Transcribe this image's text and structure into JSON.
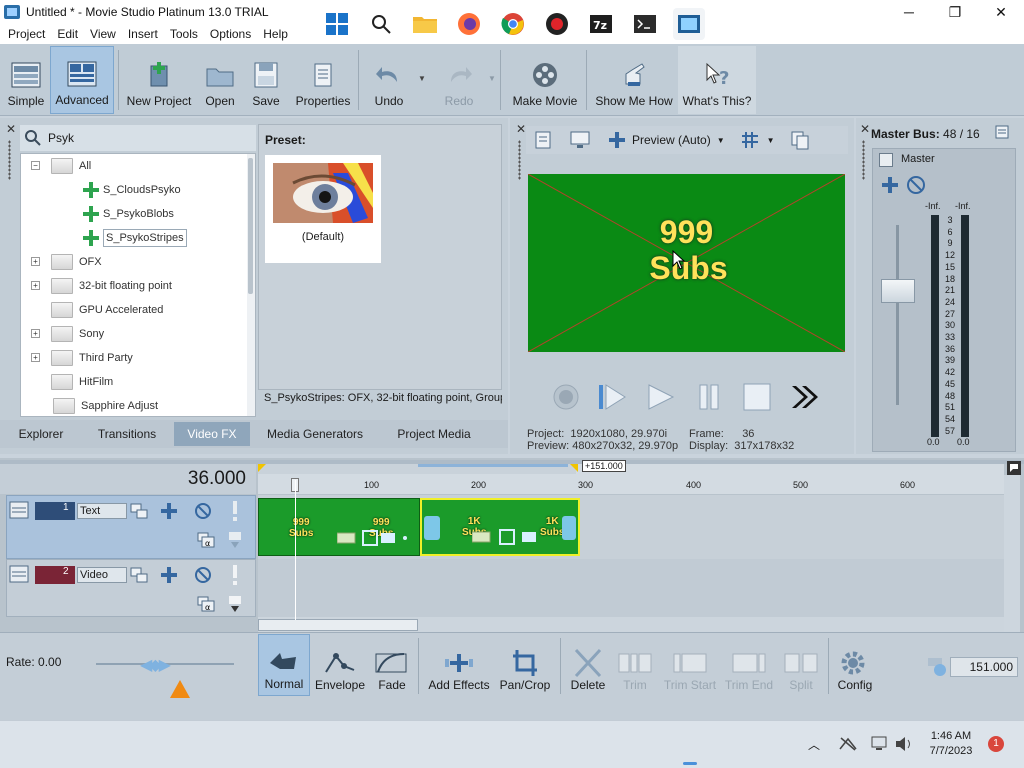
{
  "window": {
    "title": "Untitled * - Movie Studio Platinum 13.0 TRIAL",
    "controls": [
      "─",
      "❐",
      "✕"
    ]
  },
  "menu": [
    "Project",
    "Edit",
    "View",
    "Insert",
    "Tools",
    "Options",
    "Help"
  ],
  "toolbar": {
    "simple": "Simple",
    "advanced": "Advanced",
    "new_project": "New Project",
    "open": "Open",
    "save": "Save",
    "properties": "Properties",
    "undo": "Undo",
    "redo": "Redo",
    "make_movie": "Make Movie",
    "show_me_how": "Show Me How",
    "whats_this": "What's This?"
  },
  "explorer": {
    "search_value": "Psyk",
    "preset_label": "Preset:",
    "preset_default": "(Default)",
    "tree": [
      {
        "label": "All",
        "type": "folder",
        "expander": "−"
      },
      {
        "label": "S_CloudsPsyko",
        "type": "plugin"
      },
      {
        "label": "S_PsykoBlobs",
        "type": "plugin"
      },
      {
        "label": "S_PsykoStripes",
        "type": "plugin",
        "selected": true
      },
      {
        "label": "OFX",
        "type": "folder",
        "expander": "+"
      },
      {
        "label": "32-bit floating point",
        "type": "folder",
        "expander": "+"
      },
      {
        "label": "GPU Accelerated",
        "type": "folder"
      },
      {
        "label": "Sony",
        "type": "folder",
        "expander": "+"
      },
      {
        "label": "Third Party",
        "type": "folder",
        "expander": "+"
      },
      {
        "label": "HitFilm",
        "type": "folder"
      },
      {
        "label": "Sapphire Adjust",
        "type": "folder"
      }
    ],
    "status_text": "S_PsykoStripes: OFX, 32-bit floating point, Group",
    "tabs": [
      "Explorer",
      "Transitions",
      "Video FX",
      "Media Generators",
      "Project Media"
    ],
    "active_tab": "Video FX"
  },
  "preview": {
    "mode": "Preview (Auto)",
    "overlay_line1": "999",
    "overlay_line2": "Subs",
    "project_label": "Project:",
    "project_value": "1920x1080, 29.970i",
    "preview_label": "Preview:",
    "preview_value": "480x270x32, 29.970p",
    "frame_label": "Frame:",
    "frame_value": "36",
    "display_label": "Display:",
    "display_value": "317x178x32"
  },
  "master": {
    "title": "Master Bus:",
    "value": "48 / 16",
    "label": "Master",
    "inf_left": "-Inf.",
    "inf_right": "-Inf.",
    "scale": [
      "3",
      "6",
      "9",
      "12",
      "15",
      "18",
      "21",
      "24",
      "27",
      "30",
      "33",
      "36",
      "39",
      "42",
      "45",
      "48",
      "51",
      "54",
      "57"
    ],
    "bottom_left": "0.0",
    "bottom_right": "0.0"
  },
  "timeline": {
    "time": "36.000",
    "loop_label": "+151.000",
    "ruler": [
      "100",
      "200",
      "300",
      "400",
      "500",
      "600"
    ],
    "tracks": [
      {
        "number": "1",
        "name": "Text"
      },
      {
        "number": "2",
        "name": "Video"
      }
    ],
    "clip1_line1": "999",
    "clip1_line2": "Subs",
    "clip2_line1": "1K",
    "clip2_line2": "Subs",
    "rate_label": "Rate: 0.00",
    "end_time": "151.000"
  },
  "edit_tools": {
    "normal": "Normal",
    "envelope": "Envelope",
    "fade": "Fade",
    "add_effects": "Add Effects",
    "pan_crop": "Pan/Crop",
    "delete": "Delete",
    "trim": "Trim",
    "trim_start": "Trim Start",
    "trim_end": "Trim End",
    "split": "Split",
    "config": "Config"
  },
  "taskbar": {
    "time": "1:46 AM",
    "date": "7/7/2023",
    "notification_count": "1"
  }
}
